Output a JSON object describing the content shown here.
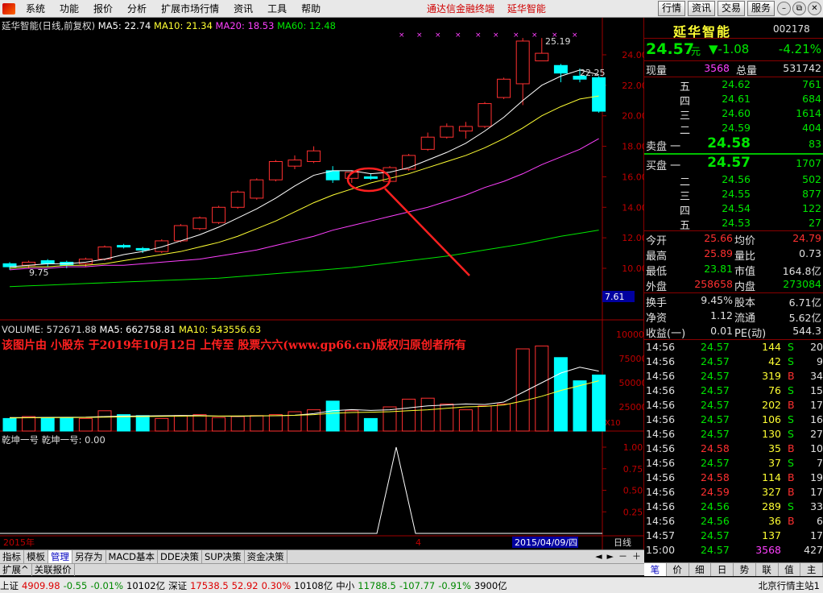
{
  "menu": {
    "items": [
      "系统",
      "功能",
      "报价",
      "分析",
      "扩展市场行情",
      "资讯",
      "工具",
      "帮助"
    ],
    "center_title": "通达信金融终端",
    "center_stock": "延华智能",
    "buttons": [
      "行情",
      "资讯",
      "交易",
      "服务"
    ]
  },
  "chart": {
    "legend": {
      "title": "延华智能(日线,前复权)",
      "ma5_label": "MA5: 22.74",
      "ma10_label": "MA10: 21.34",
      "ma20_label": "MA20: 18.53",
      "ma60_label": "MA60: 12.48"
    },
    "annot_high": "25.19",
    "annot_right": "22.25",
    "annot_low": "9.75",
    "price_axis": [
      "24.00",
      "22.00",
      "20.00",
      "18.00",
      "16.00",
      "14.00",
      "12.00",
      "10.00"
    ],
    "last_price_tag": "7.61",
    "volume_legend": {
      "volume": "VOLUME: 572671.88",
      "ma5": "MA5: 662758.81",
      "ma10": "MA10: 543556.63"
    },
    "watermark": "该图片由 小股东 于2019年10月12日 上传至 股票六六(www.gp66.cn)版权归原创者所有",
    "volume_axis": [
      "100000",
      "75000",
      "50000",
      "25000"
    ],
    "volume_unit": "X10",
    "indicator_legend": "乾坤一号  乾坤一号: 0.00",
    "indicator_axis": [
      "1.00",
      "0.75",
      "0.50",
      "0.25"
    ],
    "date_left": "2015年",
    "date_mid": "4",
    "date_cursor": "2015/04/09/四",
    "period": "日线",
    "colors": {
      "up": "#ff3030",
      "down": "#00ffff",
      "ma5": "#ffffff",
      "ma10": "#ffff33",
      "ma20": "#ff40ff",
      "ma60": "#00e600"
    }
  },
  "quote": {
    "name": "延华智能",
    "code": "002178",
    "price": "24.57",
    "price_unit": "元",
    "change": "▼-1.08",
    "change_pct": "-4.21%",
    "xianliang_label": "现量",
    "xianliang": "3568",
    "zongliang_label": "总量",
    "zongliang": "531742",
    "sell": [
      {
        "label": "五",
        "price": "24.62",
        "vol": "761"
      },
      {
        "label": "四",
        "price": "24.61",
        "vol": "684"
      },
      {
        "label": "三",
        "price": "24.60",
        "vol": "1614"
      },
      {
        "label": "二",
        "price": "24.59",
        "vol": "404"
      },
      {
        "label": "卖盘 一",
        "price": "24.58",
        "vol": "83"
      }
    ],
    "buy": [
      {
        "label": "买盘 一",
        "price": "24.57",
        "vol": "1707"
      },
      {
        "label": "二",
        "price": "24.56",
        "vol": "502"
      },
      {
        "label": "三",
        "price": "24.55",
        "vol": "877"
      },
      {
        "label": "四",
        "price": "24.54",
        "vol": "122"
      },
      {
        "label": "五",
        "price": "24.53",
        "vol": "27"
      }
    ],
    "stats": [
      {
        "l1": "今开",
        "v1": "25.66",
        "l2": "均价",
        "v2": "24.79"
      },
      {
        "l1": "最高",
        "v1": "25.89",
        "l2": "量比",
        "v2": "0.73"
      },
      {
        "l1": "最低",
        "v1": "23.81",
        "l2": "市值",
        "v2": "164.8亿"
      },
      {
        "l1": "外盘",
        "v1": "258658",
        "l2": "内盘",
        "v2": "273084"
      }
    ],
    "stats2": [
      {
        "l1": "换手",
        "v1": "9.45%",
        "l2": "股本",
        "v2": "6.71亿"
      },
      {
        "l1": "净资",
        "v1": "1.12",
        "l2": "流通",
        "v2": "5.62亿"
      },
      {
        "l1": "收益(一)",
        "v1": "0.01",
        "l2": "PE(动)",
        "v2": "544.3"
      }
    ],
    "ticks": [
      {
        "t": "14:56",
        "p": "24.57",
        "v": "144",
        "bs": "S",
        "n": "20"
      },
      {
        "t": "14:56",
        "p": "24.57",
        "v": "42",
        "bs": "S",
        "n": "9"
      },
      {
        "t": "14:56",
        "p": "24.57",
        "v": "319",
        "bs": "B",
        "n": "34"
      },
      {
        "t": "14:56",
        "p": "24.57",
        "v": "76",
        "bs": "S",
        "n": "15"
      },
      {
        "t": "14:56",
        "p": "24.57",
        "v": "202",
        "bs": "B",
        "n": "17"
      },
      {
        "t": "14:56",
        "p": "24.57",
        "v": "106",
        "bs": "S",
        "n": "16"
      },
      {
        "t": "14:56",
        "p": "24.57",
        "v": "130",
        "bs": "S",
        "n": "27"
      },
      {
        "t": "14:56",
        "p": "24.58",
        "v": "35",
        "bs": "B",
        "n": "10"
      },
      {
        "t": "14:56",
        "p": "24.57",
        "v": "37",
        "bs": "S",
        "n": "7"
      },
      {
        "t": "14:56",
        "p": "24.58",
        "v": "114",
        "bs": "B",
        "n": "19"
      },
      {
        "t": "14:56",
        "p": "24.59",
        "v": "327",
        "bs": "B",
        "n": "17"
      },
      {
        "t": "14:56",
        "p": "24.56",
        "v": "289",
        "bs": "S",
        "n": "33"
      },
      {
        "t": "14:56",
        "p": "24.56",
        "v": "36",
        "bs": "B",
        "n": "6"
      },
      {
        "t": "14:57",
        "p": "24.57",
        "v": "137",
        "bs": "",
        "n": "17"
      },
      {
        "t": "15:00",
        "p": "24.57",
        "v": "3568",
        "bs": "",
        "n": "427"
      }
    ]
  },
  "bottom_tabs": [
    "指标",
    "模板",
    "管理",
    "另存为",
    "MACD基本",
    "DDE决策",
    "SUP决策",
    "资金决策"
  ],
  "bottom_tabs2": [
    "扩展^",
    "关联报价"
  ],
  "right_tabs": [
    "笔",
    "价",
    "细",
    "日",
    "势",
    "联",
    "值",
    "主"
  ],
  "status": {
    "sh_label": "上证",
    "sh_val": "4909.98",
    "sh_chg": "-0.55",
    "sh_pct": "-0.01%",
    "sh_amt": "10102亿",
    "sz_label": "深证",
    "sz_val": "17538.5",
    "sz_chg": "52.92",
    "sz_pct": "0.30%",
    "sz_amt": "10108亿",
    "zx_label": "中小",
    "zx_val": "11788.5",
    "zx_chg": "-107.77",
    "zx_pct": "-0.91%",
    "zx_amt": "3900亿",
    "server": "北京行情主站1"
  }
}
